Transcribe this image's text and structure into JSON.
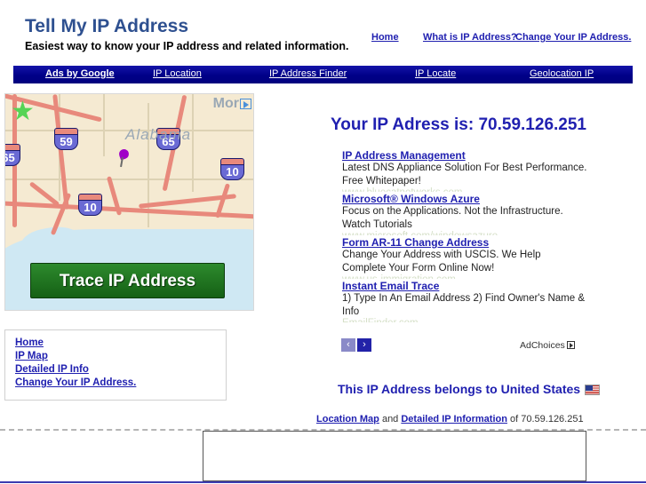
{
  "header": {
    "title": "Tell My IP Address",
    "tagline": "Easiest way to know your IP address and related information.",
    "nav": [
      {
        "label": "Home"
      },
      {
        "label": "What is IP Address?"
      },
      {
        "label": "Change Your IP Address."
      }
    ]
  },
  "ads_strip": {
    "label": "Ads by Google",
    "items": [
      {
        "label": "IP Location"
      },
      {
        "label": "IP Address Finder"
      },
      {
        "label": "IP Locate"
      },
      {
        "label": "Geolocation IP"
      }
    ]
  },
  "map_ad": {
    "button_label": "Trace IP Address",
    "state_label": "Alabama",
    "more_label": "Mor",
    "shields": [
      {
        "number": "65"
      },
      {
        "number": "59"
      },
      {
        "number": "65"
      },
      {
        "number": "10"
      },
      {
        "number": "10"
      }
    ],
    "adchoices_icon": "adchoices-triangle-icon"
  },
  "link_box": {
    "links": [
      {
        "label": "Home"
      },
      {
        "label": "IP Map"
      },
      {
        "label": "Detailed IP Info"
      },
      {
        "label": "Change Your IP Address."
      }
    ]
  },
  "main": {
    "ip_headline": "Your IP Adress is: 70.59.126.251",
    "ip_address": "70.59.126.251",
    "country_text": "This IP Address belongs to United States",
    "country_flag": "us-flag-icon",
    "detail_prefix": "",
    "detail_link_1": "Location Map",
    "detail_middle": " and ",
    "detail_link_2": "Detailed IP Information",
    "detail_suffix": " of 70.59.126.251"
  },
  "ad_block": {
    "items": [
      {
        "title": "IP Address Management",
        "line1": "Latest DNS Appliance Solution For Best Performance.",
        "line2": "Free Whitepaper!",
        "url": "www.bluecatnetworks.com"
      },
      {
        "title": "Microsoft® Windows Azure",
        "line1": "Focus on the Applications. Not the Infrastructure.",
        "line2": "Watch Tutorials",
        "url": "www.microsoft.com/windowsazure"
      },
      {
        "title": "Form AR-11 Change Address",
        "line1": "Change Your Address with USCIS. We Help",
        "line2": "Complete Your Form Online Now!",
        "url": "www.us-immigration.com"
      },
      {
        "title": "Instant Email Trace",
        "line1": "1) Type In An Email Address 2) Find Owner's Name &",
        "line2": "Info",
        "url": "EmailFinder.com"
      }
    ],
    "prev_arrow": "‹",
    "next_arrow": "›",
    "adchoices_label": "AdChoices"
  }
}
